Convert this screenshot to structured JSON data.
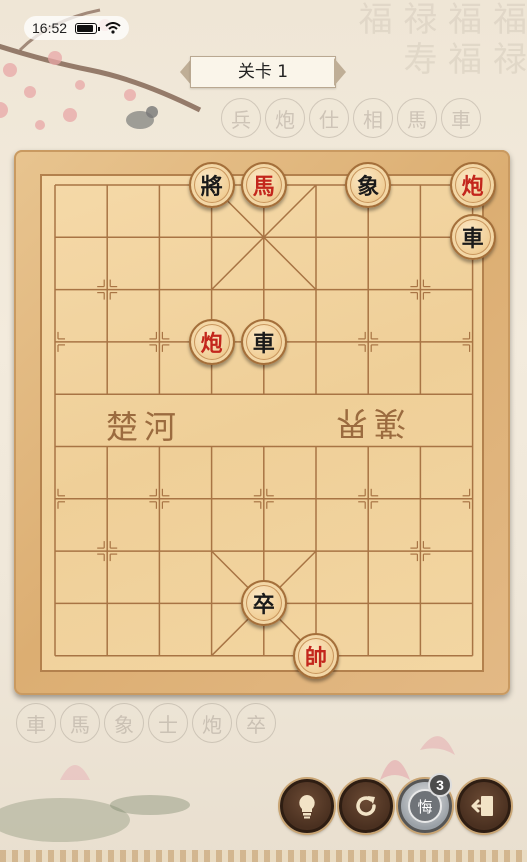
{
  "status_bar": {
    "time": "16:52"
  },
  "level": {
    "label": "关卡 1"
  },
  "captured_top": [
    "兵",
    "炮",
    "仕",
    "相",
    "馬",
    "車"
  ],
  "captured_bottom": [
    "車",
    "馬",
    "象",
    "士",
    "炮",
    "卒"
  ],
  "river": {
    "left_text": "楚河",
    "right_text": "漢界"
  },
  "pieces": [
    {
      "id": "black-general",
      "char": "將",
      "side": "black",
      "file": 3,
      "rank": 0
    },
    {
      "id": "red-horse",
      "char": "馬",
      "side": "red",
      "file": 4,
      "rank": 0
    },
    {
      "id": "black-elephant",
      "char": "象",
      "side": "black",
      "file": 6,
      "rank": 0
    },
    {
      "id": "red-cannon-top",
      "char": "炮",
      "side": "red",
      "file": 8,
      "rank": 0
    },
    {
      "id": "black-chariot-right",
      "char": "車",
      "side": "black",
      "file": 8,
      "rank": 1
    },
    {
      "id": "red-cannon-mid",
      "char": "炮",
      "side": "red",
      "file": 3,
      "rank": 3
    },
    {
      "id": "black-chariot-mid",
      "char": "車",
      "side": "black",
      "file": 4,
      "rank": 3
    },
    {
      "id": "black-soldier",
      "char": "卒",
      "side": "black",
      "file": 4,
      "rank": 8
    },
    {
      "id": "red-marshal",
      "char": "帥",
      "side": "red",
      "file": 5,
      "rank": 9
    }
  ],
  "controls": {
    "hint_icon": "lightbulb-icon",
    "restart_icon": "refresh-icon",
    "undo_label": "悔",
    "undo_count": "3",
    "exit_icon": "exit-door-icon"
  }
}
